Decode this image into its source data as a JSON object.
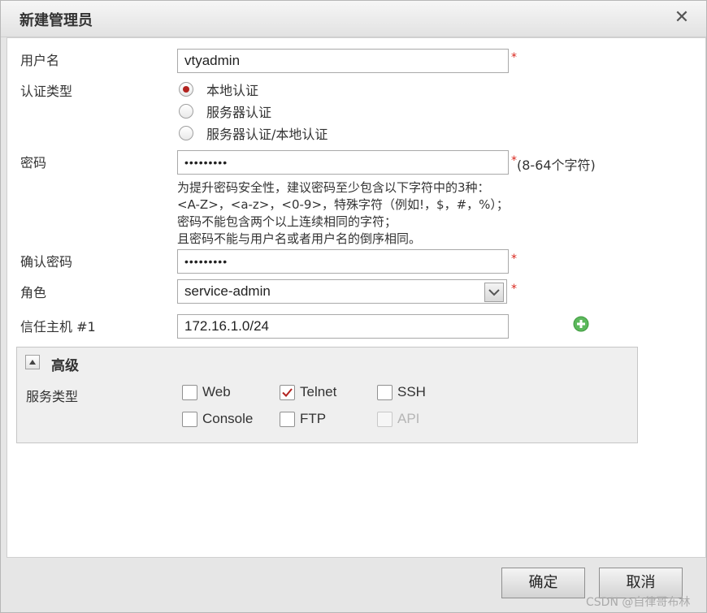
{
  "dialog": {
    "title": "新建管理员",
    "close_symbol": "✕"
  },
  "form": {
    "username": {
      "label": "用户名",
      "value": "vtyadmin",
      "required": "*"
    },
    "auth_type": {
      "label": "认证类型",
      "options": [
        {
          "label": "本地认证",
          "selected": true
        },
        {
          "label": "服务器认证",
          "selected": false
        },
        {
          "label": "服务器认证/本地认证",
          "selected": false
        }
      ]
    },
    "password": {
      "label": "密码",
      "value": "•••••••••",
      "required": "*",
      "note": "(8-64个字符)"
    },
    "password_hint": "为提升密码安全性，建议密码至少包含以下字符中的3种：\n<A-Z>，<a-z>，<0-9>，特殊字符（例如!，$，#，%）；\n密码不能包含两个以上连续相同的字符；\n且密码不能与用户名或者用户名的倒序相同。",
    "confirm_password": {
      "label": "确认密码",
      "value": "•••••••••",
      "required": "*"
    },
    "role": {
      "label": "角色",
      "value": "service-admin",
      "required": "*"
    },
    "trusted_host": {
      "label": "信任主机 #1",
      "value": "172.16.1.0/24"
    }
  },
  "advanced": {
    "title": "高级",
    "service_type_label": "服务类型",
    "services": [
      {
        "label": "Web",
        "checked": false,
        "disabled": false
      },
      {
        "label": "Telnet",
        "checked": true,
        "disabled": false
      },
      {
        "label": "SSH",
        "checked": false,
        "disabled": false
      },
      {
        "label": "Console",
        "checked": false,
        "disabled": false
      },
      {
        "label": "FTP",
        "checked": false,
        "disabled": false
      },
      {
        "label": "API",
        "checked": false,
        "disabled": true
      }
    ]
  },
  "buttons": {
    "ok": "确定",
    "cancel": "取消"
  },
  "watermark": "CSDN @自律哥布林",
  "colors": {
    "required": "#d9261c",
    "radio_selected": "#b2231f",
    "check": "#b2231f",
    "add_icon": "#5cb85c"
  },
  "icons": {
    "close": "close-icon",
    "dropdown": "chevron-down-icon",
    "add": "add-circle-icon",
    "collapse": "triangle-up-icon"
  }
}
